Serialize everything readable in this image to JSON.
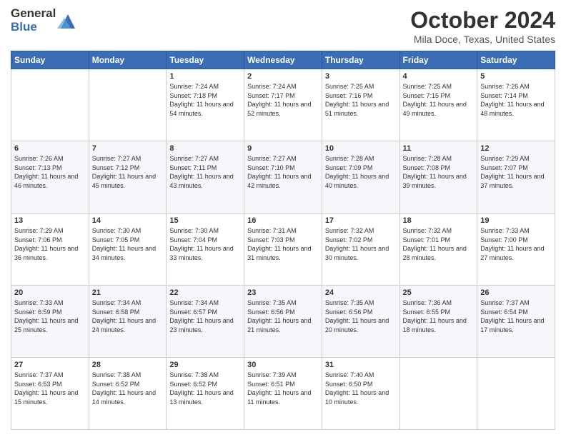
{
  "header": {
    "logo_general": "General",
    "logo_blue": "Blue",
    "month_title": "October 2024",
    "location": "Mila Doce, Texas, United States"
  },
  "days_of_week": [
    "Sunday",
    "Monday",
    "Tuesday",
    "Wednesday",
    "Thursday",
    "Friday",
    "Saturday"
  ],
  "weeks": [
    [
      {
        "day": "",
        "sunrise": "",
        "sunset": "",
        "daylight": ""
      },
      {
        "day": "",
        "sunrise": "",
        "sunset": "",
        "daylight": ""
      },
      {
        "day": "1",
        "sunrise": "Sunrise: 7:24 AM",
        "sunset": "Sunset: 7:18 PM",
        "daylight": "Daylight: 11 hours and 54 minutes."
      },
      {
        "day": "2",
        "sunrise": "Sunrise: 7:24 AM",
        "sunset": "Sunset: 7:17 PM",
        "daylight": "Daylight: 11 hours and 52 minutes."
      },
      {
        "day": "3",
        "sunrise": "Sunrise: 7:25 AM",
        "sunset": "Sunset: 7:16 PM",
        "daylight": "Daylight: 11 hours and 51 minutes."
      },
      {
        "day": "4",
        "sunrise": "Sunrise: 7:25 AM",
        "sunset": "Sunset: 7:15 PM",
        "daylight": "Daylight: 11 hours and 49 minutes."
      },
      {
        "day": "5",
        "sunrise": "Sunrise: 7:26 AM",
        "sunset": "Sunset: 7:14 PM",
        "daylight": "Daylight: 11 hours and 48 minutes."
      }
    ],
    [
      {
        "day": "6",
        "sunrise": "Sunrise: 7:26 AM",
        "sunset": "Sunset: 7:13 PM",
        "daylight": "Daylight: 11 hours and 46 minutes."
      },
      {
        "day": "7",
        "sunrise": "Sunrise: 7:27 AM",
        "sunset": "Sunset: 7:12 PM",
        "daylight": "Daylight: 11 hours and 45 minutes."
      },
      {
        "day": "8",
        "sunrise": "Sunrise: 7:27 AM",
        "sunset": "Sunset: 7:11 PM",
        "daylight": "Daylight: 11 hours and 43 minutes."
      },
      {
        "day": "9",
        "sunrise": "Sunrise: 7:27 AM",
        "sunset": "Sunset: 7:10 PM",
        "daylight": "Daylight: 11 hours and 42 minutes."
      },
      {
        "day": "10",
        "sunrise": "Sunrise: 7:28 AM",
        "sunset": "Sunset: 7:09 PM",
        "daylight": "Daylight: 11 hours and 40 minutes."
      },
      {
        "day": "11",
        "sunrise": "Sunrise: 7:28 AM",
        "sunset": "Sunset: 7:08 PM",
        "daylight": "Daylight: 11 hours and 39 minutes."
      },
      {
        "day": "12",
        "sunrise": "Sunrise: 7:29 AM",
        "sunset": "Sunset: 7:07 PM",
        "daylight": "Daylight: 11 hours and 37 minutes."
      }
    ],
    [
      {
        "day": "13",
        "sunrise": "Sunrise: 7:29 AM",
        "sunset": "Sunset: 7:06 PM",
        "daylight": "Daylight: 11 hours and 36 minutes."
      },
      {
        "day": "14",
        "sunrise": "Sunrise: 7:30 AM",
        "sunset": "Sunset: 7:05 PM",
        "daylight": "Daylight: 11 hours and 34 minutes."
      },
      {
        "day": "15",
        "sunrise": "Sunrise: 7:30 AM",
        "sunset": "Sunset: 7:04 PM",
        "daylight": "Daylight: 11 hours and 33 minutes."
      },
      {
        "day": "16",
        "sunrise": "Sunrise: 7:31 AM",
        "sunset": "Sunset: 7:03 PM",
        "daylight": "Daylight: 11 hours and 31 minutes."
      },
      {
        "day": "17",
        "sunrise": "Sunrise: 7:32 AM",
        "sunset": "Sunset: 7:02 PM",
        "daylight": "Daylight: 11 hours and 30 minutes."
      },
      {
        "day": "18",
        "sunrise": "Sunrise: 7:32 AM",
        "sunset": "Sunset: 7:01 PM",
        "daylight": "Daylight: 11 hours and 28 minutes."
      },
      {
        "day": "19",
        "sunrise": "Sunrise: 7:33 AM",
        "sunset": "Sunset: 7:00 PM",
        "daylight": "Daylight: 11 hours and 27 minutes."
      }
    ],
    [
      {
        "day": "20",
        "sunrise": "Sunrise: 7:33 AM",
        "sunset": "Sunset: 6:59 PM",
        "daylight": "Daylight: 11 hours and 25 minutes."
      },
      {
        "day": "21",
        "sunrise": "Sunrise: 7:34 AM",
        "sunset": "Sunset: 6:58 PM",
        "daylight": "Daylight: 11 hours and 24 minutes."
      },
      {
        "day": "22",
        "sunrise": "Sunrise: 7:34 AM",
        "sunset": "Sunset: 6:57 PM",
        "daylight": "Daylight: 11 hours and 23 minutes."
      },
      {
        "day": "23",
        "sunrise": "Sunrise: 7:35 AM",
        "sunset": "Sunset: 6:56 PM",
        "daylight": "Daylight: 11 hours and 21 minutes."
      },
      {
        "day": "24",
        "sunrise": "Sunrise: 7:35 AM",
        "sunset": "Sunset: 6:56 PM",
        "daylight": "Daylight: 11 hours and 20 minutes."
      },
      {
        "day": "25",
        "sunrise": "Sunrise: 7:36 AM",
        "sunset": "Sunset: 6:55 PM",
        "daylight": "Daylight: 11 hours and 18 minutes."
      },
      {
        "day": "26",
        "sunrise": "Sunrise: 7:37 AM",
        "sunset": "Sunset: 6:54 PM",
        "daylight": "Daylight: 11 hours and 17 minutes."
      }
    ],
    [
      {
        "day": "27",
        "sunrise": "Sunrise: 7:37 AM",
        "sunset": "Sunset: 6:53 PM",
        "daylight": "Daylight: 11 hours and 15 minutes."
      },
      {
        "day": "28",
        "sunrise": "Sunrise: 7:38 AM",
        "sunset": "Sunset: 6:52 PM",
        "daylight": "Daylight: 11 hours and 14 minutes."
      },
      {
        "day": "29",
        "sunrise": "Sunrise: 7:38 AM",
        "sunset": "Sunset: 6:52 PM",
        "daylight": "Daylight: 11 hours and 13 minutes."
      },
      {
        "day": "30",
        "sunrise": "Sunrise: 7:39 AM",
        "sunset": "Sunset: 6:51 PM",
        "daylight": "Daylight: 11 hours and 11 minutes."
      },
      {
        "day": "31",
        "sunrise": "Sunrise: 7:40 AM",
        "sunset": "Sunset: 6:50 PM",
        "daylight": "Daylight: 11 hours and 10 minutes."
      },
      {
        "day": "",
        "sunrise": "",
        "sunset": "",
        "daylight": ""
      },
      {
        "day": "",
        "sunrise": "",
        "sunset": "",
        "daylight": ""
      }
    ]
  ]
}
